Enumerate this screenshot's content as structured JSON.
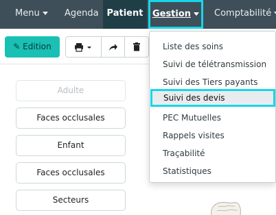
{
  "navbar": {
    "items": [
      {
        "label": "Menu"
      },
      {
        "label": "Agenda"
      },
      {
        "label": "Patient"
      },
      {
        "label": "Gestion"
      },
      {
        "label": "Comptabilité"
      }
    ]
  },
  "toolbar": {
    "edit_label": "Edition",
    "icons": [
      "print-icon",
      "chevron-down-icon",
      "share-icon",
      "trash-icon"
    ]
  },
  "side_buttons": [
    {
      "label": "Adulte"
    },
    {
      "label": "Faces occlusales"
    },
    {
      "label": "Enfant"
    },
    {
      "label": "Faces occlusales"
    },
    {
      "label": "Secteurs"
    }
  ],
  "gestion_menu": {
    "items": [
      {
        "label": "Liste des soins"
      },
      {
        "label": "Suivi de télétransmission"
      },
      {
        "label": "Suivi des Tiers payants"
      },
      {
        "label": "Suivi des devis"
      },
      {
        "label": "PEC Mutuelles"
      },
      {
        "label": "Rappels visites"
      },
      {
        "label": "Traçabilité"
      },
      {
        "label": "Statistiques"
      }
    ]
  },
  "colors": {
    "navbar_bg": "#3f4f59",
    "active_tab_bg": "#1f3e45",
    "highlight": "#16d7ea",
    "edit_button": "#19c0b3"
  }
}
